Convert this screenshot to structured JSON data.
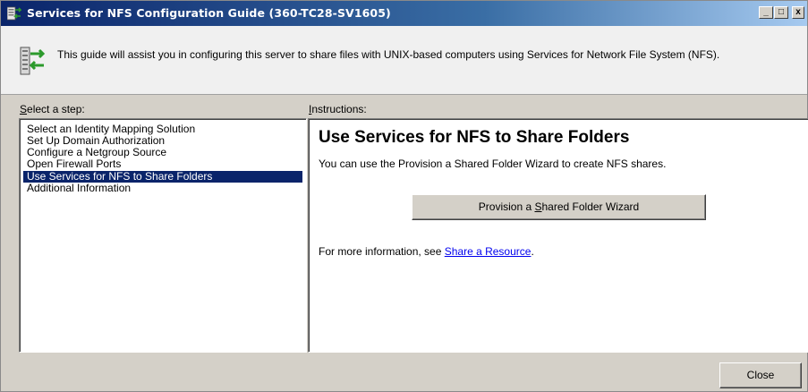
{
  "window": {
    "title": "Services for NFS Configuration Guide (360-TC28-SV1605)",
    "buttons": {
      "minimize": "_",
      "maximize": "□",
      "close": "x"
    }
  },
  "header": {
    "description": "This guide will assist you in configuring this server to share files with UNIX-based computers using Services for Network File System (NFS).",
    "icon": "nfs-config-icon"
  },
  "steps_panel": {
    "label_first": "S",
    "label_rest": "elect a step:",
    "items": [
      {
        "label": "Select an Identity Mapping Solution",
        "selected": false
      },
      {
        "label": "Set Up Domain Authorization",
        "selected": false
      },
      {
        "label": "Configure a Netgroup Source",
        "selected": false
      },
      {
        "label": "Open Firewall Ports",
        "selected": false
      },
      {
        "label": "Use Services for NFS to Share Folders",
        "selected": true
      },
      {
        "label": "Additional Information",
        "selected": false
      }
    ]
  },
  "instructions_panel": {
    "label_first": "I",
    "label_rest": "nstructions:",
    "title": "Use Services for NFS to Share Folders",
    "text": "You can use the Provision a Shared Folder Wizard to create NFS shares.",
    "wizard_button": {
      "pre": "Provision a ",
      "accel": "S",
      "post": "hared Folder Wizard"
    },
    "more_info_prefix": "For more information, see ",
    "more_info_link": "Share a Resource",
    "more_info_suffix": "."
  },
  "footer": {
    "close_label": "Close"
  },
  "colors": {
    "selection": "#0a246a",
    "link": "#0000ee",
    "face": "#d4d0c8"
  }
}
